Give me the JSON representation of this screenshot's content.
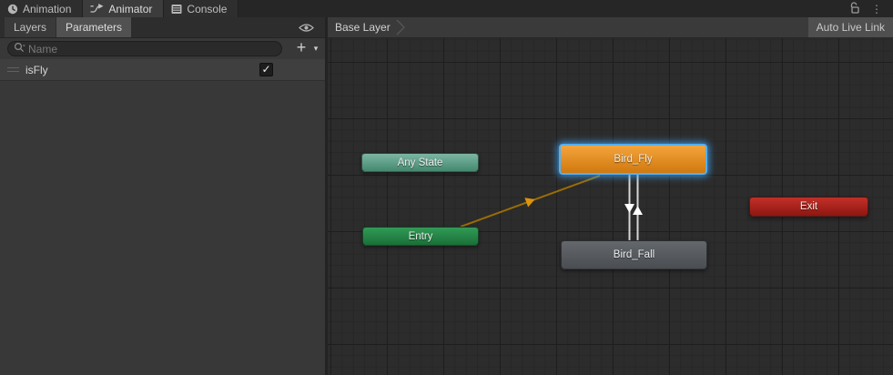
{
  "window": {
    "tabs": [
      {
        "label": "Animation",
        "icon": "clock-icon",
        "active": false
      },
      {
        "label": "Animator",
        "icon": "animator-icon",
        "active": true
      },
      {
        "label": "Console",
        "icon": "console-icon",
        "active": false
      }
    ],
    "titlebar_icons": [
      "unlock-icon",
      "kebab-menu-icon"
    ],
    "kebab_glyph": "⋮"
  },
  "sidebar": {
    "tabs": [
      {
        "label": "Layers",
        "selected": false
      },
      {
        "label": "Parameters",
        "selected": true
      }
    ],
    "eye_icon": "eye-icon",
    "search": {
      "placeholder": "Name",
      "icon": "search-icon"
    },
    "add_button_label": "+",
    "add_button_caret": "▾",
    "parameters": [
      {
        "name": "isFly",
        "type": "bool",
        "checked": true,
        "checkmark": "✓"
      }
    ]
  },
  "graph": {
    "breadcrumb": "Base Layer",
    "auto_live_link_label": "Auto Live Link",
    "nodes": [
      {
        "id": "any-state",
        "label": "Any State",
        "color_top": "#7cb6a4",
        "color_bottom": "#44886f",
        "selected": false
      },
      {
        "id": "entry",
        "label": "Entry",
        "color_top": "#319b56",
        "color_bottom": "#1a6f38",
        "selected": false
      },
      {
        "id": "bird-fly",
        "label": "Bird_Fly",
        "color_top": "#f4a43c",
        "color_bottom": "#d0790f",
        "selected": true,
        "selection_color": "#55b0f4"
      },
      {
        "id": "bird-fall",
        "label": "Bird_Fall",
        "color_top": "#64686d",
        "color_bottom": "#4a4e53",
        "selected": false
      },
      {
        "id": "exit",
        "label": "Exit",
        "color_top": "#c23028",
        "color_bottom": "#8d1711",
        "selected": false
      }
    ],
    "transitions": [
      {
        "from": "Entry",
        "to": "Bird_Fly",
        "color": "#9a6c06",
        "arrow_color": "#dd940c"
      },
      {
        "from": "Bird_Fly",
        "to": "Bird_Fall",
        "color": "#d6d6d6",
        "arrow_color": "#ffffff"
      },
      {
        "from": "Bird_Fall",
        "to": "Bird_Fly",
        "color": "#d6d6d6",
        "arrow_color": "#ffffff"
      }
    ]
  }
}
